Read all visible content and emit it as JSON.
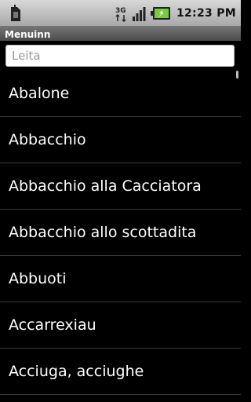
{
  "status_bar": {
    "time": "12:23 PM",
    "icons": [
      "sim-card-icon",
      "data-3g-icon",
      "signal-strength-icon",
      "battery-charging-icon"
    ]
  },
  "title_bar": {
    "title": "Menuinn"
  },
  "search": {
    "placeholder": "Leita",
    "value": ""
  },
  "list": {
    "items": [
      {
        "label": "Abalone"
      },
      {
        "label": "Abbacchio"
      },
      {
        "label": "Abbacchio alla Cacciatora"
      },
      {
        "label": "Abbacchio allo scottadita"
      },
      {
        "label": "Abbuoti"
      },
      {
        "label": "Accarrexiau"
      },
      {
        "label": "Acciuga, acciughe"
      }
    ]
  },
  "colors": {
    "background": "#000000",
    "list_text": "#ffffff",
    "divider": "#3a3a3a",
    "battery_green": "#7ac943"
  }
}
